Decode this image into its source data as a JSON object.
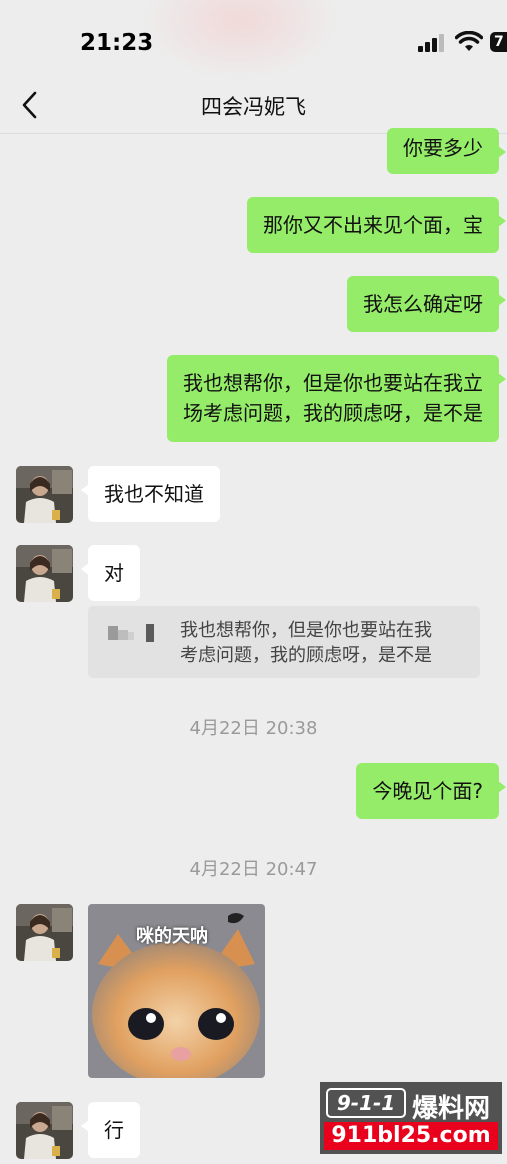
{
  "status_bar": {
    "time": "21:23",
    "battery": "7"
  },
  "nav": {
    "title": "四会冯妮飞"
  },
  "messages": [
    {
      "text": "你要多少"
    },
    {
      "text": "那你又不出来见个面，宝"
    },
    {
      "text": "我怎么确定呀"
    },
    {
      "text_line1": "我也想帮你，但是你也要站在我立",
      "text_line2": "场考虑问题，我的顾虑呀，是不是"
    },
    {
      "text": "我也不知道"
    },
    {
      "text": "对"
    },
    {
      "text": "今晚见个面?"
    },
    {
      "text": "行"
    }
  ],
  "quote": {
    "line1": "我也想帮你，但是你也要站在我",
    "line2": "考虑问题，我的顾虑呀，是不是"
  },
  "timestamps": [
    "4月22日 20:38",
    "4月22日 20:47"
  ],
  "sticker": {
    "caption": "咪的天呐"
  },
  "watermark": {
    "logo": "9-1-1",
    "name": "爆料网",
    "url": "911bl25.com"
  },
  "colors": {
    "sent_bubble": "#95ec69",
    "recv_bubble": "#ffffff",
    "background": "#ededed",
    "watermark_red": "#e8001c"
  }
}
